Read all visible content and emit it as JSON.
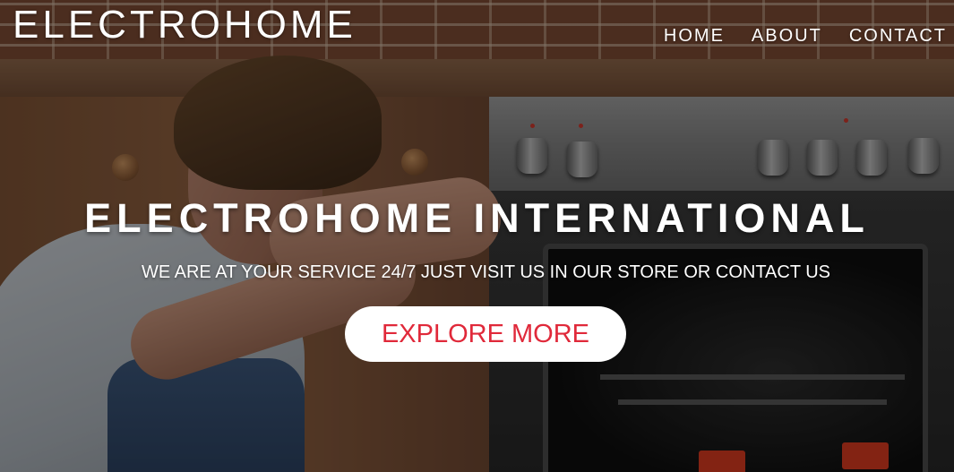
{
  "header": {
    "logo_text": "ELECTROHOME",
    "nav": [
      {
        "label": "HOME"
      },
      {
        "label": "ABOUT"
      },
      {
        "label": "CONTACT"
      }
    ]
  },
  "hero": {
    "background_image": "man-repairing-oven-photo",
    "headline": "ELECTROHOME INTERNATIONAL",
    "tagline": "WE ARE AT YOUR SERVICE 24/7 JUST VISIT US IN OUR STORE OR CONTACT US",
    "cta_label": "EXPLORE MORE"
  },
  "colors": {
    "text": "#ffffff",
    "cta_background": "#ffffff",
    "cta_text": "#e0293a"
  }
}
